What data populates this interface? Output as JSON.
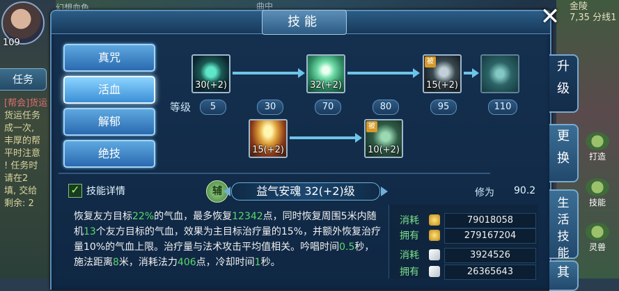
{
  "background": {
    "player_name": "幻想血色",
    "level": "109",
    "left_tab": "任务",
    "left_panel_lines": [
      "[帮会]货运",
      "货运任务",
      "成一次,",
      "丰厚的帮",
      "平时注意",
      "! 任务时",
      "  请在2",
      "填, 交给",
      "剩余: 2"
    ],
    "top_mid_text": "曲中",
    "top_right_location": "金陵",
    "top_right_sub": "7,35 分线1",
    "right_button_1": "打造",
    "right_button_2": "技能",
    "right_button_3": "灵兽"
  },
  "window": {
    "title": "技能",
    "close_icon": "close-x-icon"
  },
  "side_tabs": [
    "升级",
    "更换",
    "生活技能",
    "其"
  ],
  "skill_buttons": [
    "真咒",
    "活血",
    "解郁",
    "绝技"
  ],
  "active_skill_button": "活血",
  "skill_tree": {
    "nodes": [
      {
        "icon": "serpent-skill-icon",
        "label": "30(+2)",
        "passive": false
      },
      {
        "icon": "radiant-palm-skill-icon",
        "label": "32(+2)",
        "passive": false
      },
      {
        "icon": "shadow-warrior-skill-icon",
        "label": "15(+2)",
        "passive": true,
        "badge": "被"
      },
      {
        "icon": "locked-skill-icon",
        "label": "",
        "passive": false
      },
      {
        "icon": "golden-halo-skill-icon",
        "label": "15(+2)",
        "passive": false
      },
      {
        "icon": "beast-skill-icon",
        "label": "10(+2)",
        "passive": true,
        "badge": "被"
      }
    ],
    "grade_label": "等级",
    "grades": [
      "5",
      "30",
      "70",
      "80",
      "95",
      "110"
    ]
  },
  "detail": {
    "check_label": "技能详情",
    "type_badge": "辅",
    "skill_name": "益气安魂 32(+2)级",
    "cultivation_label": "修为",
    "cultivation_value": "90.2",
    "desc_parts": [
      {
        "t": "恢复友方目标",
        "g": false
      },
      {
        "t": "22%",
        "g": true
      },
      {
        "t": "的气血，最多恢复",
        "g": false
      },
      {
        "t": "12342",
        "g": true
      },
      {
        "t": "点，同时恢复周围5米内随机",
        "g": false
      },
      {
        "t": "13",
        "g": true
      },
      {
        "t": "个友方目标的气血，效果为主目标治疗量的15%，并额外恢复治疗量10%的气血上限。治疗量与法术攻击平均值相关。吟唱时间",
        "g": false
      },
      {
        "t": "0.5",
        "g": true
      },
      {
        "t": "秒，施法距离",
        "g": false
      },
      {
        "t": "8",
        "g": true
      },
      {
        "t": "米，消耗法力",
        "g": false
      },
      {
        "t": "406",
        "g": true
      },
      {
        "t": "点，冷却时间",
        "g": false
      },
      {
        "t": "1",
        "g": true
      },
      {
        "t": "秒。",
        "g": false
      }
    ]
  },
  "costs": [
    {
      "key": "消耗",
      "icon": "gold-coin-icon",
      "value": "79018058"
    },
    {
      "key": "拥有",
      "icon": "gold-coin-icon",
      "value": "279167204"
    },
    {
      "key": "消耗",
      "icon": "silver-scroll-icon",
      "value": "3924526"
    },
    {
      "key": "拥有",
      "icon": "silver-scroll-icon",
      "value": "26365643"
    }
  ],
  "colors": {
    "highlight_green": "#59d86a",
    "panel_bg": "#153150",
    "accent_blue": "#6ec4e8"
  }
}
